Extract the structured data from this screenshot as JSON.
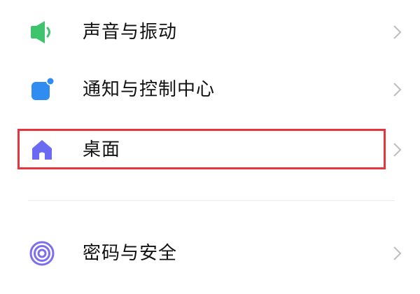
{
  "settings": {
    "items": [
      {
        "label": "声音与振动",
        "icon": "speaker-icon",
        "color": "#3ec46d"
      },
      {
        "label": "通知与控制中心",
        "icon": "notification-icon",
        "color": "#2f8cf0"
      },
      {
        "label": "桌面",
        "icon": "home-icon",
        "color": "#6a6bf2",
        "highlighted": true
      },
      {
        "label": "密码与安全",
        "icon": "fingerprint-icon",
        "color": "#7b6ff0"
      }
    ],
    "highlight_color": "#e5363b"
  }
}
